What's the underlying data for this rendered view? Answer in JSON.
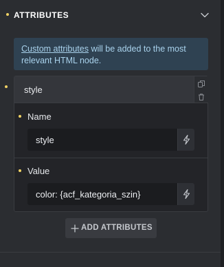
{
  "section": {
    "title": "ATTRIBUTES"
  },
  "info": {
    "link_text": "Custom attributes",
    "text": " will be added to the most relevant HTML node."
  },
  "attribute": {
    "header_label": "style",
    "name_label": "Name",
    "name_value": "style",
    "value_label": "Value",
    "value_value": "color: {acf_kategoria_szin}"
  },
  "add_button": {
    "label": "ADD ATTRIBUTES"
  },
  "icons": {
    "section_chevron": "chevron-down-icon",
    "duplicate": "copy-icon",
    "delete": "trash-icon",
    "dynamic_data": "bolt-icon",
    "add": "plus-icon"
  },
  "colors": {
    "accent_dot": "#f0d264",
    "info_bg": "#2f4252",
    "info_text": "#a9d2ec"
  }
}
